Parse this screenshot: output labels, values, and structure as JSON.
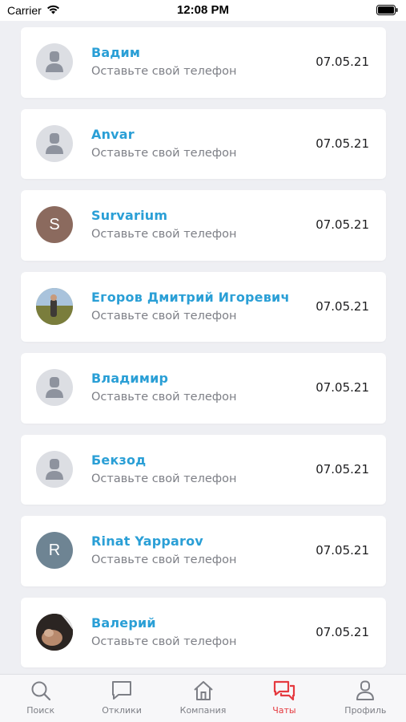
{
  "status_bar": {
    "carrier": "Carrier",
    "time": "12:08 PM"
  },
  "chats": [
    {
      "name": "Вадим",
      "message": "Оставьте свой телефон",
      "date": "07.05.21",
      "avatar": "placeholder"
    },
    {
      "name": "Anvar",
      "message": "Оставьте свой телефон",
      "date": "07.05.21",
      "avatar": "placeholder"
    },
    {
      "name": "Survarium",
      "message": "Оставьте свой телефон",
      "date": "07.05.21",
      "avatar": "letter",
      "initial": "S",
      "avatar_color": "#8b6a5e"
    },
    {
      "name": "Егоров Дмитрий Игоревич",
      "message": "Оставьте свой телефон",
      "date": "07.05.21",
      "avatar": "photo"
    },
    {
      "name": "Владимир",
      "message": "Оставьте свой телефон",
      "date": "07.05.21",
      "avatar": "placeholder"
    },
    {
      "name": "Бекзод",
      "message": "Оставьте свой телефон",
      "date": "07.05.21",
      "avatar": "placeholder"
    },
    {
      "name": "Rinat Yapparov",
      "message": "Оставьте свой телефон",
      "date": "07.05.21",
      "avatar": "letter",
      "initial": "R",
      "avatar_color": "#6e8493"
    },
    {
      "name": "Валерий",
      "message": "Оставьте свой телефон",
      "date": "07.05.21",
      "avatar": "photo"
    }
  ],
  "tabs": [
    {
      "label": "Поиск",
      "icon": "search-icon"
    },
    {
      "label": "Отклики",
      "icon": "chat-bubble-icon"
    },
    {
      "label": "Компания",
      "icon": "home-icon"
    },
    {
      "label": "Чаты",
      "icon": "chats-icon",
      "active": true
    },
    {
      "label": "Профиль",
      "icon": "profile-icon"
    }
  ],
  "colors": {
    "accent": "#2a9fd6",
    "active_tab": "#e53a40",
    "inactive_tab": "#7d7f86",
    "background": "#eeeff3"
  }
}
